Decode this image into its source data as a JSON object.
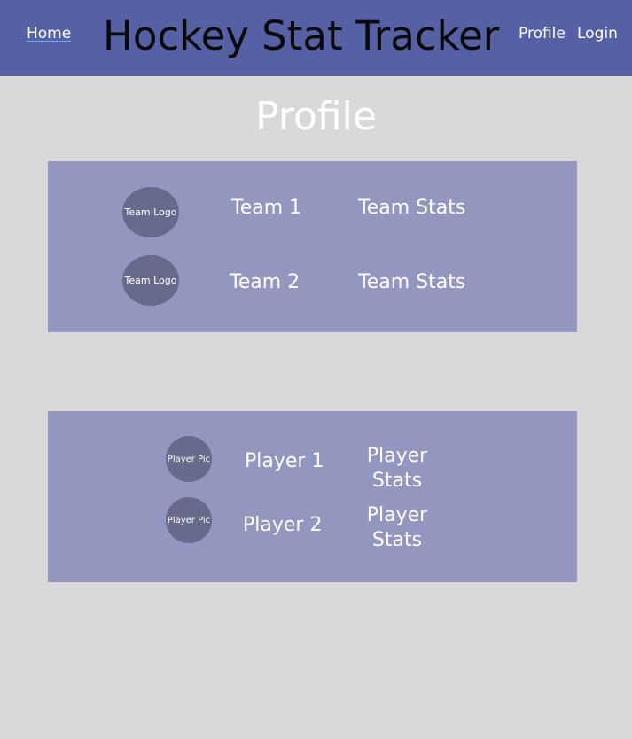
{
  "header": {
    "home_label": "Home",
    "title": "Hockey Stat Tracker",
    "profile_label": "Profile",
    "login_label": "Login"
  },
  "page": {
    "title": "Profile"
  },
  "teams": [
    {
      "logo_label": "Team Logo",
      "name": "Team 1",
      "stats_label": "Team Stats"
    },
    {
      "logo_label": "Team Logo",
      "name": "Team 2",
      "stats_label": "Team Stats"
    }
  ],
  "players": [
    {
      "pic_label": "Player Pic",
      "name": "Player 1",
      "stats_line1": "Player",
      "stats_line2": "Stats"
    },
    {
      "pic_label": "Player Pic",
      "name": "Player 2",
      "stats_line1": "Player",
      "stats_line2": "Stats"
    }
  ],
  "colors": {
    "header_bg": "#5660a4",
    "page_bg": "#d9d9d9",
    "panel_bg": "#9396be",
    "circle_bg": "#676a8a",
    "text": "#ffffff",
    "title_text": "#0a0a0a"
  }
}
